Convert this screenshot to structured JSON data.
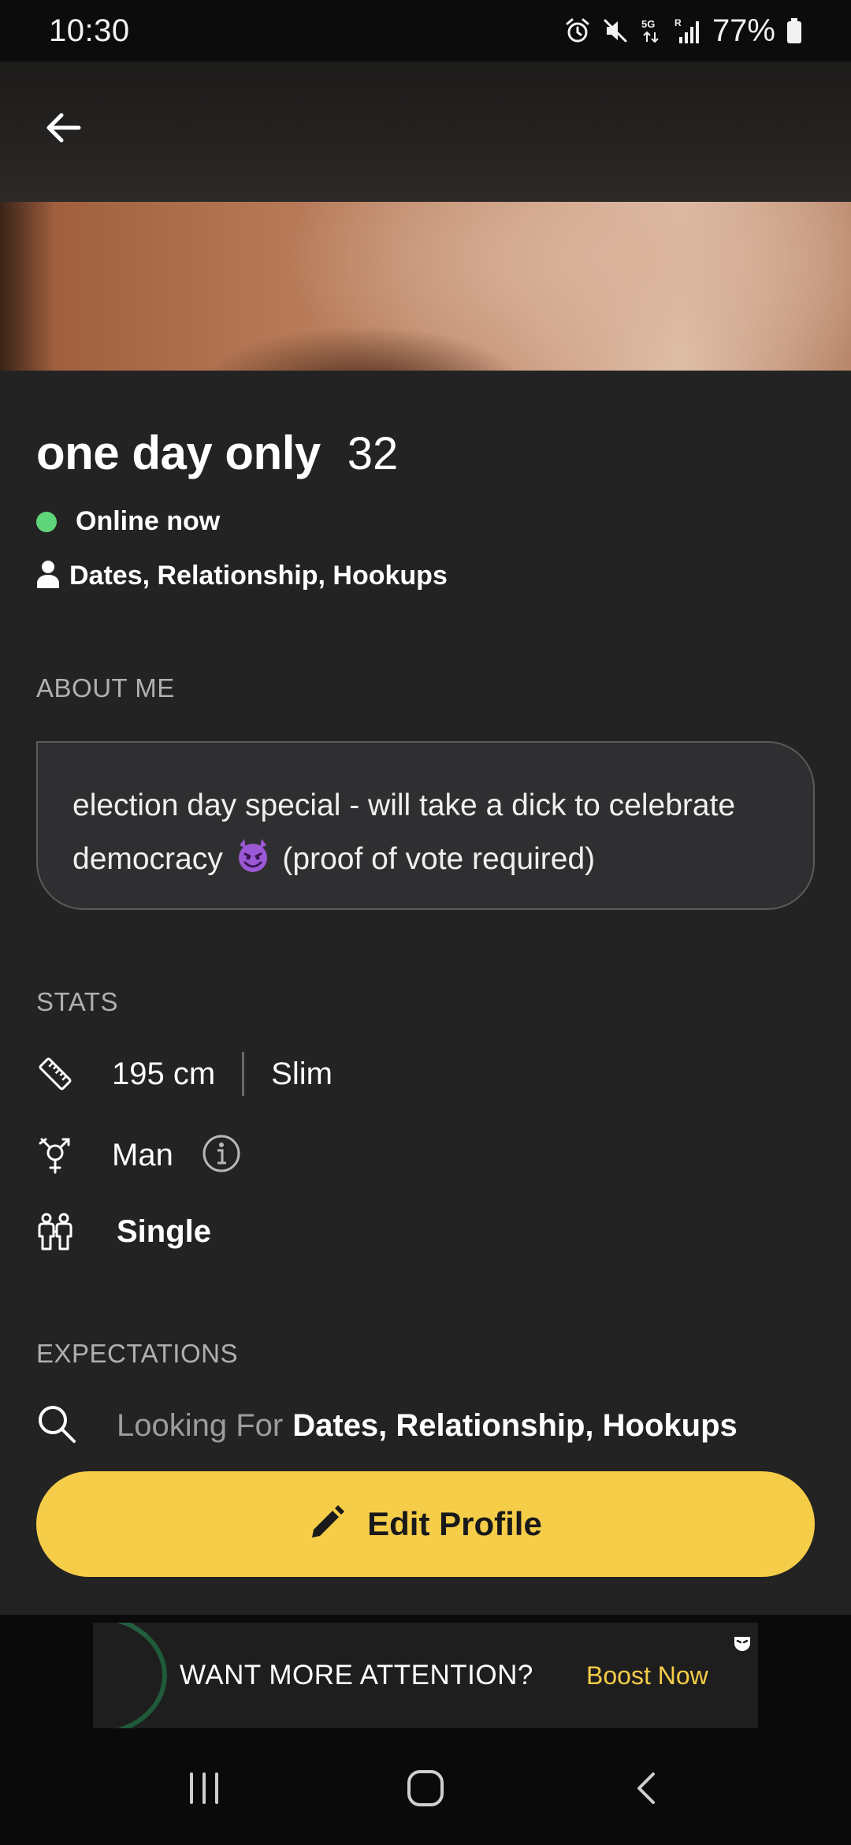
{
  "status_bar": {
    "time": "10:30",
    "battery": "77%",
    "network": "5G",
    "roaming_label": "R",
    "icons": [
      "alarm-icon",
      "mute-icon",
      "network-5g-icon",
      "signal-icon",
      "battery-icon"
    ]
  },
  "header": {
    "back_icon": "arrow-left-icon"
  },
  "profile": {
    "display_name": "one day only",
    "age": "32",
    "online_status": "Online now",
    "looking_for_summary": "Dates, Relationship, Hookups"
  },
  "about": {
    "section_label": "ABOUT ME",
    "text_before_emoji": "election day special - will take a dick to celebrate democracy",
    "emoji": "smiling-devil-emoji",
    "text_after_emoji": "(proof of vote required)"
  },
  "stats": {
    "section_label": "STATS",
    "height": "195 cm",
    "body_type": "Slim",
    "gender": "Man",
    "relationship_status": "Single"
  },
  "expectations": {
    "section_label": "EXPECTATIONS",
    "looking_for_label": "Looking For",
    "looking_for_value": "Dates, Relationship, Hookups"
  },
  "actions": {
    "edit_profile_label": "Edit Profile"
  },
  "ad": {
    "headline": "WANT MORE ATTENTION?",
    "cta": "Boost Now"
  },
  "colors": {
    "accent_yellow": "#f6cd48",
    "online_green": "#5fd47a",
    "background": "#232323"
  }
}
